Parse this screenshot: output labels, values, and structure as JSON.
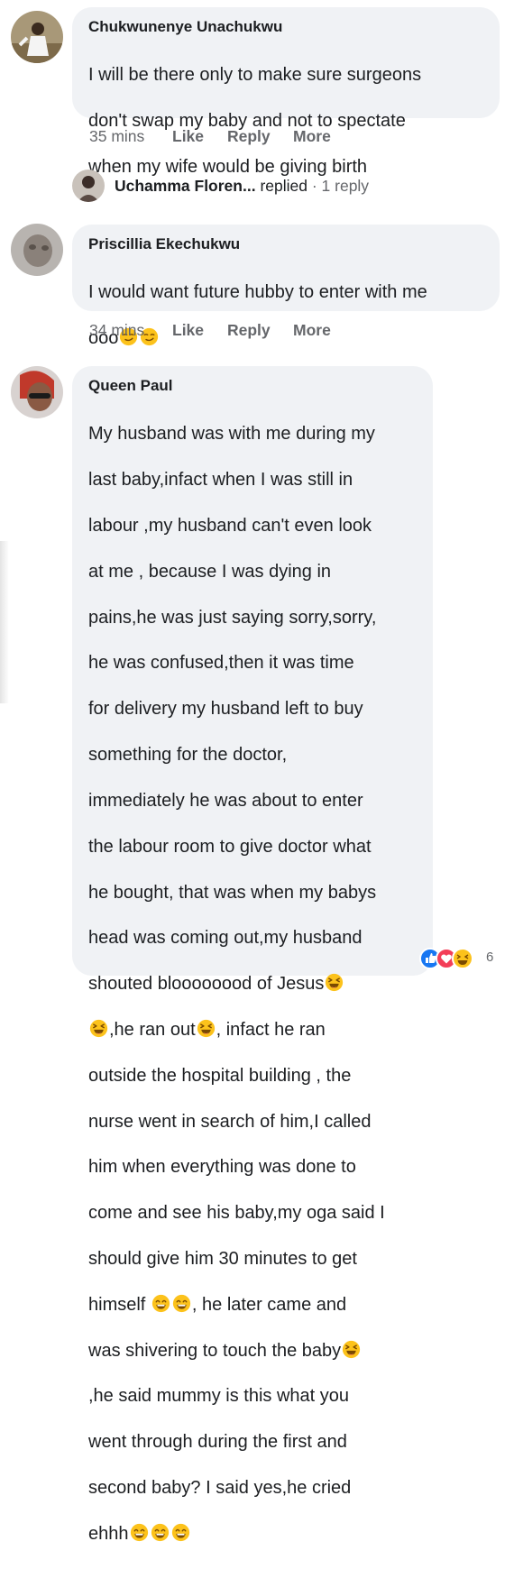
{
  "comments": [
    {
      "author": "Chukwunenye Unachukwu",
      "text_lines": [
        "I will be there only to make sure surgeons",
        "don't swap my baby and not to spectate",
        "when my wife would be giving birth"
      ],
      "time": "35 mins",
      "like": "Like",
      "reply": "Reply",
      "more": "More"
    },
    {
      "author": "Priscillia Ekechukwu",
      "text_lines": [
        "I would want future hubby to enter with me",
        "ooo"
      ],
      "time": "34 mins",
      "like": "Like",
      "reply": "Reply",
      "more": "More"
    },
    {
      "author": "Queen Paul",
      "text_lines": [
        "My husband was with me during my",
        "last baby,infact when I was still in",
        "labour ,my husband can't even look",
        "at me , because I was dying in",
        "pains,he was just saying sorry,sorry,",
        "he was confused,then it was time",
        "for delivery my husband left to buy",
        "something for the doctor,",
        "immediately he was about to enter",
        "the labour room to give doctor what",
        "he bought, that was when my babys",
        "head was coming out,my husband",
        "shouted bloooooood of Jesus",
        ",he ran out",
        "outside the hospital building , the",
        "nurse went in search of him,I called",
        "him when everything was done to",
        "come and see his baby,my oga said I",
        "should give him 30 minutes to get",
        "himself",
        "was shivering to touch the baby",
        ",he said mummy is this what you",
        "went through during the first and",
        "second baby? I said yes,he cried",
        "ehhh"
      ],
      "text_fragments": {
        "line15_after": ", infact he ran",
        "line20_after": ", he later came and"
      },
      "reaction_count": "6"
    }
  ],
  "reply_thread": {
    "name": "Uchamma Floren...",
    "action": " replied",
    "count": " · 1 reply"
  },
  "icons": {
    "smirk": "smirking-face-icon",
    "laugh": "laughing-squinting-face-icon",
    "grin": "grinning-face-icon",
    "like_reaction": "like-reaction-icon",
    "love_reaction": "love-reaction-icon",
    "haha_reaction": "haha-reaction-icon"
  },
  "colors": {
    "bubble": "#f0f2f5",
    "muted": "#65676b",
    "like_blue": "#1877f2",
    "love_red": "#f33e58",
    "emoji_yellow": "#fcc21b"
  }
}
